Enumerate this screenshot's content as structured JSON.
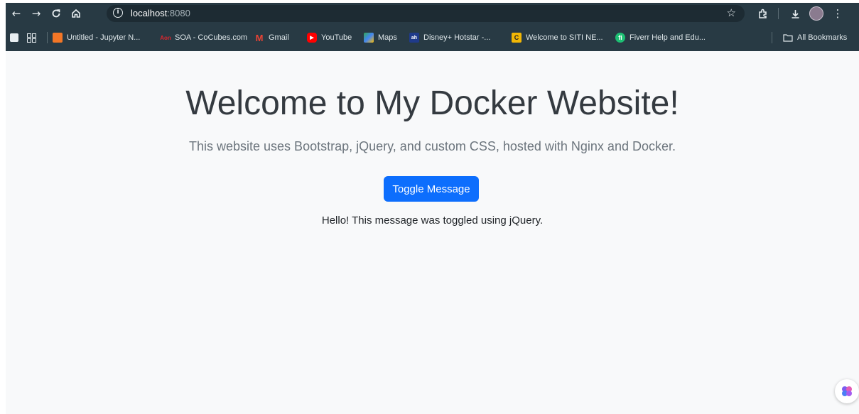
{
  "browser": {
    "url_host": "localhost",
    "url_port": ":8080",
    "bookmarks": [
      {
        "label": "Untitled - Jupyter N...",
        "icon": "jupyter-icon",
        "color": "#f37626"
      },
      {
        "label": "SOA - CoCubes.com",
        "icon": "cocubes-icon",
        "color": "#d9262e"
      },
      {
        "label": "Gmail",
        "icon": "gmail-icon",
        "color": "#ea4335"
      },
      {
        "label": "YouTube",
        "icon": "youtube-icon",
        "color": "#ff0000"
      },
      {
        "label": "Maps",
        "icon": "maps-icon",
        "color": "#34a853"
      },
      {
        "label": "Disney+ Hotstar -...",
        "icon": "hotstar-icon",
        "color": "#1f3a8a"
      },
      {
        "label": "Welcome to SITI NE...",
        "icon": "siti-icon",
        "color": "#f2b705"
      },
      {
        "label": "Fiverr Help and Edu...",
        "icon": "fiverr-icon",
        "color": "#1dbf73"
      }
    ],
    "all_bookmarks_label": "All Bookmarks"
  },
  "page": {
    "title": "Welcome to My Docker Website!",
    "subtitle": "This website uses Bootstrap, jQuery, and custom CSS, hosted with Nginx and Docker.",
    "toggle_button_label": "Toggle Message",
    "message": "Hello! This message was toggled using jQuery."
  },
  "colors": {
    "chrome_bg": "#283a44",
    "page_bg": "#f8f9fa",
    "primary_button": "#0d6efd"
  }
}
